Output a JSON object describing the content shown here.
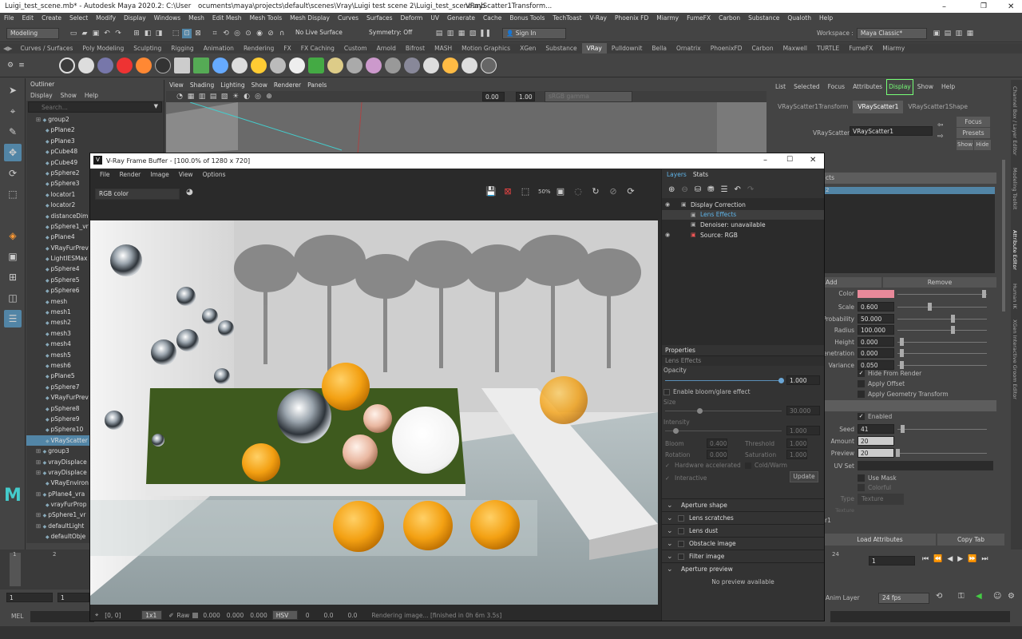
{
  "window": {
    "title_left": "Luigi_test_scene.mb* - Autodesk Maya 2020.2: C:\\User",
    "title_mid": "ocuments\\maya\\projects\\default\\scenes\\Vray\\Luigi test scene 2\\Luigi_test_scene.mb",
    "title_right": "VRayScatter1Transform..."
  },
  "menus": [
    "File",
    "Edit",
    "Create",
    "Select",
    "Modify",
    "Display",
    "Windows",
    "Mesh",
    "Edit Mesh",
    "Mesh Tools",
    "Mesh Display",
    "Curves",
    "Surfaces",
    "Deform",
    "UV",
    "Generate",
    "Cache",
    "Bonus Tools",
    "TechToast",
    "V-Ray",
    "Phoenix FD",
    "Miarmy",
    "FumeFX",
    "Carbon",
    "Substance",
    "Qualoth",
    "Help"
  ],
  "workspace": {
    "label": "Workspace :",
    "value": "Maya Classic*"
  },
  "status_line": {
    "mode": "Modeling",
    "live_surface": "No Live Surface",
    "symmetry": "Symmetry: Off",
    "sign_in": "Sign In"
  },
  "shelf_tabs": [
    "Curves / Surfaces",
    "Poly Modeling",
    "Sculpting",
    "Rigging",
    "Animation",
    "Rendering",
    "FX",
    "FX Caching",
    "Custom",
    "Arnold",
    "Bifrost",
    "MASH",
    "Motion Graphics",
    "XGen",
    "Substance",
    "VRay",
    "Pulldownit",
    "Bella",
    "Ornatrix",
    "PhoenixFD",
    "Carbon",
    "Maxwell",
    "TURTLE",
    "FumeFX",
    "Miarmy"
  ],
  "shelf_active": "VRay",
  "outliner": {
    "title": "Outliner",
    "menu": [
      "Display",
      "Show",
      "Help"
    ],
    "search_placeholder": "Search...",
    "items": [
      {
        "label": "group2",
        "sel": false
      },
      {
        "label": "pPlane2",
        "sel": false
      },
      {
        "label": "pPlane3",
        "sel": false
      },
      {
        "label": "pCube48",
        "sel": false
      },
      {
        "label": "pCube49",
        "sel": false
      },
      {
        "label": "pSphere2",
        "sel": false
      },
      {
        "label": "pSphere3",
        "sel": false
      },
      {
        "label": "locator1",
        "sel": false
      },
      {
        "label": "locator2",
        "sel": false
      },
      {
        "label": "distanceDim",
        "sel": false
      },
      {
        "label": "pSphere1_vr",
        "sel": false
      },
      {
        "label": "pPlane4",
        "sel": false
      },
      {
        "label": "VRayFurPrev",
        "sel": false
      },
      {
        "label": "LightIESMax",
        "sel": false
      },
      {
        "label": "pSphere4",
        "sel": false
      },
      {
        "label": "pSphere5",
        "sel": false
      },
      {
        "label": "pSphere6",
        "sel": false
      },
      {
        "label": "mesh",
        "sel": false
      },
      {
        "label": "mesh1",
        "sel": false
      },
      {
        "label": "mesh2",
        "sel": false
      },
      {
        "label": "mesh3",
        "sel": false
      },
      {
        "label": "mesh4",
        "sel": false
      },
      {
        "label": "mesh5",
        "sel": false
      },
      {
        "label": "mesh6",
        "sel": false
      },
      {
        "label": "pPlane5",
        "sel": false
      },
      {
        "label": "pSphere7",
        "sel": false
      },
      {
        "label": "VRayFurPrev",
        "sel": false
      },
      {
        "label": "pSphere8",
        "sel": false
      },
      {
        "label": "pSphere9",
        "sel": false
      },
      {
        "label": "pSphere10",
        "sel": false
      },
      {
        "label": "VRayScatter",
        "sel": true
      },
      {
        "label": "group3",
        "sel": false
      },
      {
        "label": "vrayDisplace",
        "sel": false
      },
      {
        "label": "vrayDisplace",
        "sel": false
      },
      {
        "label": "VRayEnviron",
        "sel": false
      },
      {
        "label": "pPlane4_vra",
        "sel": false
      },
      {
        "label": "vrayFurProp",
        "sel": false
      },
      {
        "label": "pSphere1_vr",
        "sel": false
      },
      {
        "label": "defaultLight",
        "sel": false
      },
      {
        "label": "defaultObje",
        "sel": false
      }
    ]
  },
  "viewport": {
    "menu": [
      "View",
      "Shading",
      "Lighting",
      "Show",
      "Renderer",
      "Panels"
    ],
    "val_a": "0.00",
    "val_b": "1.00",
    "colorspace": "sRGB gamma"
  },
  "attr_editor": {
    "menu": [
      "List",
      "Selected",
      "Focus",
      "Attributes",
      "Display",
      "Show",
      "Help"
    ],
    "tabs": [
      "VRayScatter1Transform",
      "VRayScatter1",
      "VRayScatter1Shape"
    ],
    "active_tab": "VRayScatter1",
    "node_label": "VRayScatter:",
    "node_value": "VRayScatter1",
    "focus_btn": "Focus",
    "presets_btn": "Presets",
    "show_btn": "Show",
    "hide_btn": "Hide",
    "section_frag": "cts",
    "list_item_frag": "2",
    "add_btn": "Add",
    "remove_btn": "Remove",
    "color_label": "Color",
    "color_value": "#e9899a",
    "rows": [
      {
        "label": "Scale",
        "value": "0.600",
        "pos": 0.35
      },
      {
        "label": "Probability",
        "value": "50.000",
        "pos": 0.62
      },
      {
        "label": "Radius",
        "value": "100.000",
        "pos": 0.62
      },
      {
        "label": "Height",
        "value": "0.000",
        "pos": 0.03
      },
      {
        "label": "enetration",
        "value": "0.000",
        "pos": 0.03
      },
      {
        "label": "Variance",
        "value": "0.050",
        "pos": 0.03
      }
    ],
    "checks": [
      {
        "label": "Hide From Render",
        "checked": true
      },
      {
        "label": "Apply Offset",
        "checked": false
      },
      {
        "label": "Apply Geometry Transform",
        "checked": false
      }
    ],
    "enabled_label": "Enabled",
    "seed_label": "Seed",
    "seed_value": "41",
    "amount_label": "Amount",
    "amount_value": "20",
    "preview_label": "Preview",
    "preview_value": "20",
    "uvset_label": "UV Set",
    "usemask_label": "Use Mask",
    "colorful_label": "Colorful",
    "type_label": "Type",
    "type_value": "Texture",
    "texture_label": "Texture",
    "frag_bottom": "r1",
    "load_btn": "Load Attributes",
    "copy_btn": "Copy Tab",
    "side_tabs": [
      "Channel Box / Layer Editor",
      "Modeling Toolkit",
      "Attribute Editor",
      "Human IK",
      "XGen Interactive Groom Editor"
    ]
  },
  "frame_buffer": {
    "title": "V-Ray Frame Buffer - [100.0% of 1280 x 720]",
    "menu": [
      "File",
      "Render",
      "Image",
      "View",
      "Options"
    ],
    "channel": "RGB color",
    "tabs": [
      "Layers",
      "Stats"
    ],
    "layers": [
      {
        "label": "Display Correction",
        "indent": 0
      },
      {
        "label": "Lens Effects",
        "indent": 1
      },
      {
        "label": "Denoiser: unavailable",
        "indent": 1
      },
      {
        "label": "Source: RGB",
        "indent": 1
      }
    ],
    "properties_title": "Properties",
    "properties_subtitle": "Lens Effects",
    "opacity_label": "Opacity",
    "opacity_value": "1.000",
    "bloom_enable": "Enable bloom/glare effect",
    "size_label": "Size",
    "size_value": "30.000",
    "intensity_label": "Intensity",
    "intensity_value": "1.000",
    "bloom_label": "Bloom",
    "bloom_value": "0.400",
    "threshold_label": "Threshold",
    "threshold_value": "1.000",
    "rotation_label": "Rotation",
    "rotation_value": "0.000",
    "saturation_label": "Saturation",
    "saturation_value": "1.000",
    "hw_label": "Hardware accelerated",
    "coldwarm_label": "Cold/Warm",
    "interactive_label": "Interactive",
    "update_btn": "Update",
    "sections": [
      "Aperture shape",
      "Lens scratches",
      "Lens dust",
      "Obstacle image",
      "Filter image",
      "Aperture preview"
    ],
    "no_preview": "No preview available",
    "status": {
      "coords": "[0, 0]",
      "zoom": "1x1",
      "raw": "Raw",
      "r": "0.000",
      "g": "0.000",
      "b": "0.000",
      "mode": "HSV",
      "h": "0",
      "s": "0.0",
      "v": "0.0",
      "message": "Rendering image... [finished in  0h  6m  3.5s]"
    }
  },
  "timeline": {
    "ticks": [
      "1",
      "2"
    ],
    "start": "1",
    "start2": "1",
    "frame_right": "24",
    "current": "1"
  },
  "bottom": {
    "anim_layer": "Anim Layer",
    "fps": "24 fps",
    "mel": "MEL"
  }
}
